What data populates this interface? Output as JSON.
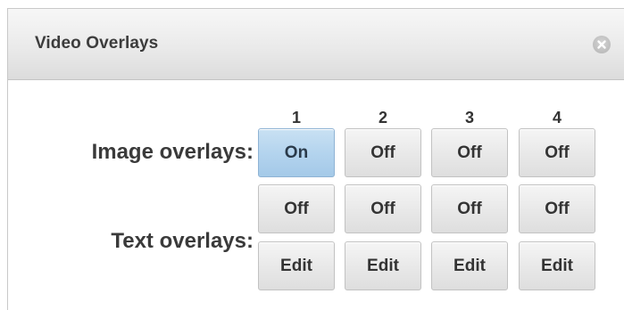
{
  "dialog": {
    "title": "Video Overlays",
    "close_icon": "close-circle-icon"
  },
  "columns": [
    "1",
    "2",
    "3",
    "4"
  ],
  "rows": {
    "image_overlays": {
      "label": "Image overlays:",
      "buttons": [
        "On",
        "Off",
        "Off",
        "Off"
      ]
    },
    "text_overlays": {
      "label": "Text overlays:",
      "toggle_buttons": [
        "Off",
        "Off",
        "Off",
        "Off"
      ],
      "edit_buttons": [
        "Edit",
        "Edit",
        "Edit",
        "Edit"
      ]
    }
  },
  "colors": {
    "active_button": "#b4d4ee",
    "inactive_button": "#e9e9e9"
  }
}
